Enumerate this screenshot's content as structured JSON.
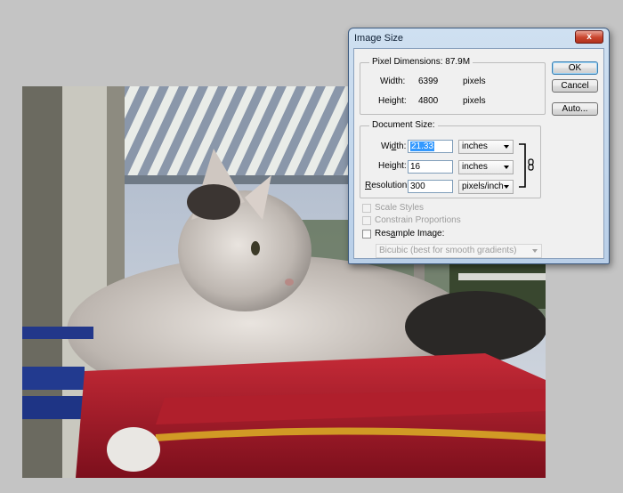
{
  "dialog": {
    "title": "Image Size",
    "close_glyph": "x",
    "pixel_dimensions": {
      "legend": "Pixel Dimensions:",
      "size": "87.9M",
      "width_label": "Width:",
      "width_value": "6399",
      "width_unit": "pixels",
      "height_label": "Height:",
      "height_value": "4800",
      "height_unit": "pixels"
    },
    "document_size": {
      "legend": "Document Size:",
      "width_label_pre": "Wi",
      "width_label_u": "d",
      "width_label_post": "th:",
      "width_value": "21.33",
      "width_unit": "inches",
      "height_label_pre": "Hei",
      "height_label_u": "g",
      "height_label_post": "ht:",
      "height_value": "16",
      "height_unit": "inches",
      "resolution_label_u": "R",
      "resolution_label_post": "esolution:",
      "resolution_value": "300",
      "resolution_unit": "pixels/inch"
    },
    "options": {
      "scale_styles": "Scale Styles",
      "scale_styles_checked": false,
      "constrain_proportions": "Constrain Proportions",
      "constrain_checked": false,
      "resample_pre": "Res",
      "resample_u": "a",
      "resample_post": "mple Image:",
      "resample_checked": false,
      "resample_method": "Bicubic (best for smooth gradients)"
    },
    "buttons": {
      "ok": "OK",
      "cancel": "Cancel",
      "auto": "Auto..."
    }
  },
  "icons": {
    "link": "chain-link-icon",
    "dropdown": "chevron-down-icon"
  }
}
